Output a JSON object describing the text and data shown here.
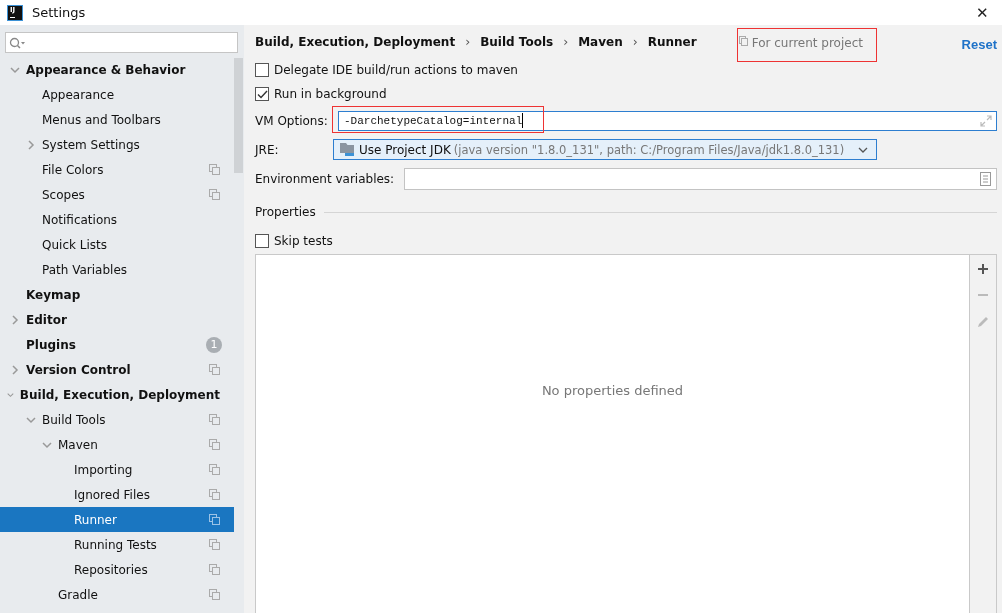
{
  "window": {
    "title": "Settings",
    "close": "✕"
  },
  "logo": "IJ",
  "breadcrumb_separator": "›",
  "tree": [
    {
      "label": "Appearance & Behavior",
      "expanded": true,
      "selected": false,
      "shared": false,
      "children": [
        {
          "label": "Appearance",
          "selected": false,
          "shared": false
        },
        {
          "label": "Menus and Toolbars",
          "selected": false,
          "shared": false
        },
        {
          "label": "System Settings",
          "expanded": false,
          "selected": false,
          "shared": false
        },
        {
          "label": "File Colors",
          "selected": false,
          "shared": true
        },
        {
          "label": "Scopes",
          "selected": false,
          "shared": true
        },
        {
          "label": "Notifications",
          "selected": false,
          "shared": false
        },
        {
          "label": "Quick Lists",
          "selected": false,
          "shared": false
        },
        {
          "label": "Path Variables",
          "selected": false,
          "shared": false
        }
      ]
    },
    {
      "label": "Keymap",
      "selected": false,
      "shared": false
    },
    {
      "label": "Editor",
      "expanded": false,
      "selected": false,
      "shared": false
    },
    {
      "label": "Plugins",
      "selected": false,
      "shared": false,
      "badge": "1"
    },
    {
      "label": "Version Control",
      "expanded": false,
      "selected": false,
      "shared": true
    },
    {
      "label": "Build, Execution, Deployment",
      "expanded": true,
      "selected": false,
      "shared": false,
      "children": [
        {
          "label": "Build Tools",
          "expanded": true,
          "selected": false,
          "shared": true,
          "children": [
            {
              "label": "Maven",
              "expanded": true,
              "selected": false,
              "shared": true,
              "children": [
                {
                  "label": "Importing",
                  "selected": false,
                  "shared": true
                },
                {
                  "label": "Ignored Files",
                  "selected": false,
                  "shared": true
                },
                {
                  "label": "Runner",
                  "selected": true,
                  "shared": true
                },
                {
                  "label": "Running Tests",
                  "selected": false,
                  "shared": true
                },
                {
                  "label": "Repositories",
                  "selected": false,
                  "shared": true
                }
              ]
            },
            {
              "label": "Gradle",
              "selected": false,
              "shared": true
            }
          ]
        }
      ]
    }
  ],
  "breadcrumb": [
    "Build, Execution, Deployment",
    "Build Tools",
    "Maven",
    "Runner"
  ],
  "scope_note": "For current project",
  "reset": "Reset",
  "options": [
    {
      "label": "Delegate IDE build/run actions to maven",
      "checked": false
    },
    {
      "label": "Run in background",
      "checked": true
    }
  ],
  "vm_options": {
    "label": "VM Options:",
    "value": "-DarchetypeCatalog=internal",
    "highlighted": true
  },
  "jre": {
    "label": "JRE:",
    "value": "Use Project JDK",
    "detail": "(java version \"1.8.0_131\", path: C:/Program Files/Java/jdk1.8.0_131)"
  },
  "env": {
    "label": "Environment variables:"
  },
  "properties": {
    "title": "Properties",
    "skip_tests": {
      "label": "Skip tests",
      "checked": false
    },
    "empty_text": "No properties defined"
  }
}
